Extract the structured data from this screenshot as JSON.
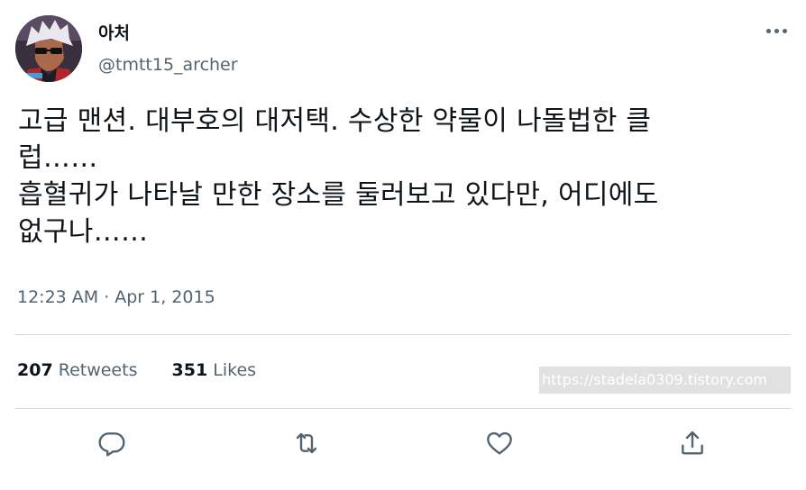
{
  "author": {
    "display_name": "아처",
    "handle": "@tmtt15_archer",
    "avatar_icon": "anime-character-avatar"
  },
  "tweet": {
    "lines": [
      "고급 맨션. 대부호의 대저택. 수상한 약물이 나돌법한 클",
      "럽……",
      "흡혈귀가 나타날 만한 장소를 둘러보고 있다만, 어디에도",
      "없구나……"
    ],
    "time": "12:23 AM",
    "separator": "·",
    "date": "Apr 1, 2015"
  },
  "stats": {
    "retweets_count": "207",
    "retweets_label": "Retweets",
    "likes_count": "351",
    "likes_label": "Likes"
  },
  "watermark": "https://stadela0309.tistory.com",
  "actions": {
    "reply_icon": "reply-icon",
    "retweet_icon": "retweet-icon",
    "like_icon": "heart-icon",
    "share_icon": "share-icon"
  },
  "colors": {
    "text": "#0f1419",
    "secondary": "#536471",
    "divider": "#cfd9de"
  }
}
